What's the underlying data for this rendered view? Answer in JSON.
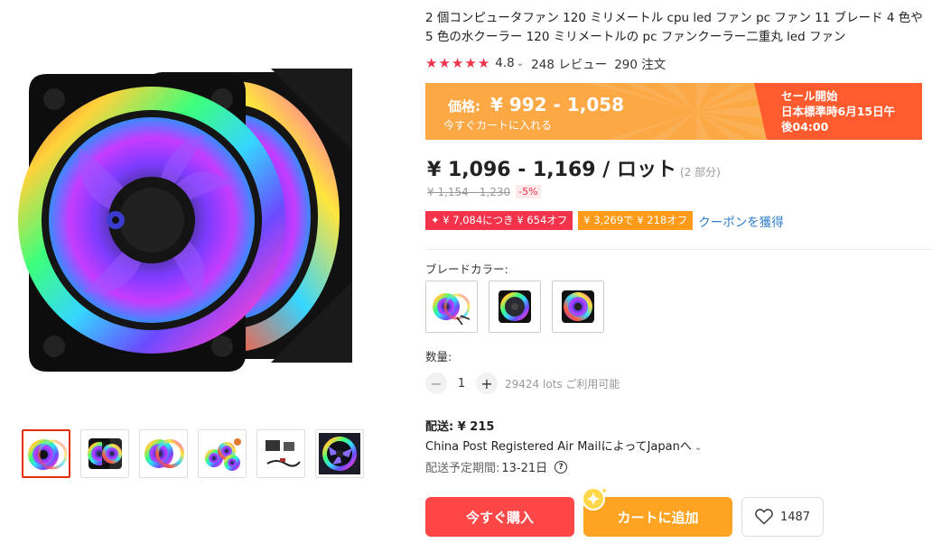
{
  "product": {
    "title": "2 個コンピュータファン 120 ミリメートル cpu led ファン pc ファン 11 ブレード 4 色や 5 色の水クーラー 120 ミリメートルの pc ファンクーラー二重丸 led ファン",
    "rating": "4.8",
    "rating_stars": 5,
    "reviews": "248 レビュー",
    "orders": "290 注文"
  },
  "promo": {
    "price_label": "価格:",
    "price": "¥ 992 - 1,058",
    "subtitle": "今すぐカートに入れる",
    "sale_line1": "セール開始",
    "sale_line2": "日本標準時6月15日午",
    "sale_line3": "後04:00"
  },
  "pricing": {
    "price": "¥ 1,096 - 1,169 / ロット",
    "unit_note": "(2 部分)",
    "original": "¥ 1,154 - 1,230",
    "discount": "-5%"
  },
  "coupons": {
    "coupon1": "✦ ¥ 7,084につき ¥ 654オフ",
    "coupon2": "¥ 3,269で ¥ 218オフ",
    "get_coupon": "クーポンを獲得"
  },
  "options": {
    "blade_label": "ブレードカラー:",
    "quantity_label": "数量:",
    "quantity_value": "1",
    "available": "29424 lots ご利用可能"
  },
  "shipping": {
    "label": "配送: ¥ 215",
    "method": "China Post Registered Air MailによってJapanへ",
    "eta_label": "配送予定期間:",
    "eta_value": "13-21日"
  },
  "actions": {
    "buy_now": "今すぐ購入",
    "add_to_cart": "カートに追加",
    "wishlist_count": "1487"
  },
  "colors": {
    "accent_red": "#ff4747",
    "accent_orange": "#ffa323",
    "promo_orange": "#fca845",
    "promo_sale": "#ff5b2e",
    "link_blue": "#2f7cc8"
  },
  "icons": {
    "star": "star-icon",
    "help": "question-icon",
    "heart": "heart-icon",
    "cart_badge": "sparkle-badge-icon"
  }
}
